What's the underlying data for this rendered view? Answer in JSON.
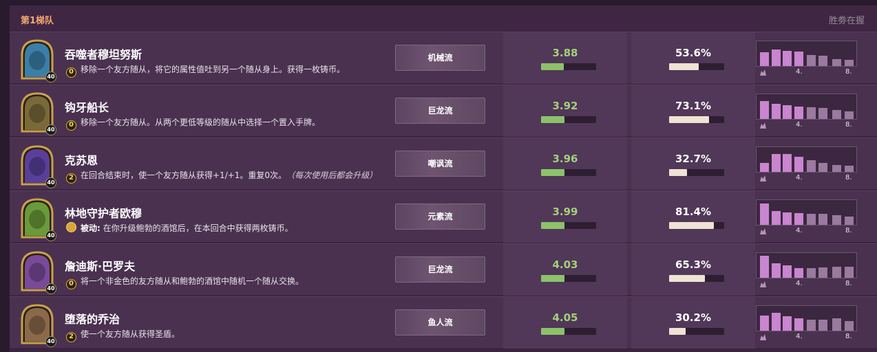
{
  "header": {
    "tier_label": "第1梯队",
    "winrate_label": "胜劵在握"
  },
  "dist_ticks": [
    "4.",
    "8."
  ],
  "heroes": [
    {
      "name": "吞噬者穆坦努斯",
      "level": "40",
      "cost": "0",
      "power": "移除一个友方随从，将它的属性值吐到另一个随从身上。获得一枚铸币。",
      "comp": "机械流",
      "placement": "3.88",
      "placement_fraction": 0.41,
      "winrate": "53.6%",
      "winrate_fraction": 0.536,
      "distribution": [
        0.55,
        0.68,
        0.6,
        0.58,
        0.44,
        0.42,
        0.28,
        0.24
      ],
      "portrait_color": "#3b7fa8"
    },
    {
      "name": "钩牙船长",
      "level": "40",
      "cost": "0",
      "power": "移除一个友方随从。从两个更低等级的随从中选择一个置入手牌。",
      "comp": "巨龙流",
      "placement": "3.92",
      "placement_fraction": 0.42,
      "winrate": "73.1%",
      "winrate_fraction": 0.731,
      "distribution": [
        0.72,
        0.6,
        0.55,
        0.5,
        0.46,
        0.44,
        0.36,
        0.3
      ],
      "portrait_color": "#7a6a3a"
    },
    {
      "name": "克苏恩",
      "level": "40",
      "cost": "2",
      "power": "在回合结束时，使一个友方随从获得+1/+1。重复0次。",
      "power_extra": "（每次使用后都会升级）",
      "comp": "嘲讽流",
      "placement": "3.96",
      "placement_fraction": 0.42,
      "winrate": "32.7%",
      "winrate_fraction": 0.327,
      "distribution": [
        0.36,
        0.72,
        0.72,
        0.62,
        0.46,
        0.36,
        0.28,
        0.26
      ],
      "portrait_color": "#5a3f9a"
    },
    {
      "name": "林地守护者欧穆",
      "level": "40",
      "cost": "",
      "power_label": "被动:",
      "power": "在你升级鲍勃的酒馆后，在本回合中获得两枚铸币。",
      "comp": "元素流",
      "placement": "3.99",
      "placement_fraction": 0.42,
      "winrate": "81.4%",
      "winrate_fraction": 0.814,
      "distribution": [
        0.86,
        0.56,
        0.5,
        0.46,
        0.44,
        0.44,
        0.4,
        0.34
      ],
      "portrait_color": "#6a9a3a"
    },
    {
      "name": "詹迪斯·巴罗夫",
      "level": "40",
      "cost": "0",
      "power": "将一个非金色的友方随从和鲍勃的酒馆中随机一个随从交换。",
      "comp": "巨龙流",
      "placement": "4.03",
      "placement_fraction": 0.43,
      "winrate": "65.3%",
      "winrate_fraction": 0.653,
      "distribution": [
        0.88,
        0.58,
        0.5,
        0.38,
        0.4,
        0.42,
        0.44,
        0.44
      ],
      "portrait_color": "#7a4a9a"
    },
    {
      "name": "堕落的乔治",
      "level": "40",
      "cost": "2",
      "power": "使一个友方随从获得圣盾。",
      "comp": "鱼人流",
      "placement": "4.05",
      "placement_fraction": 0.43,
      "winrate": "30.2%",
      "winrate_fraction": 0.302,
      "distribution": [
        0.62,
        0.72,
        0.58,
        0.5,
        0.44,
        0.44,
        0.5,
        0.4
      ],
      "portrait_color": "#8a6a4a"
    }
  ]
}
